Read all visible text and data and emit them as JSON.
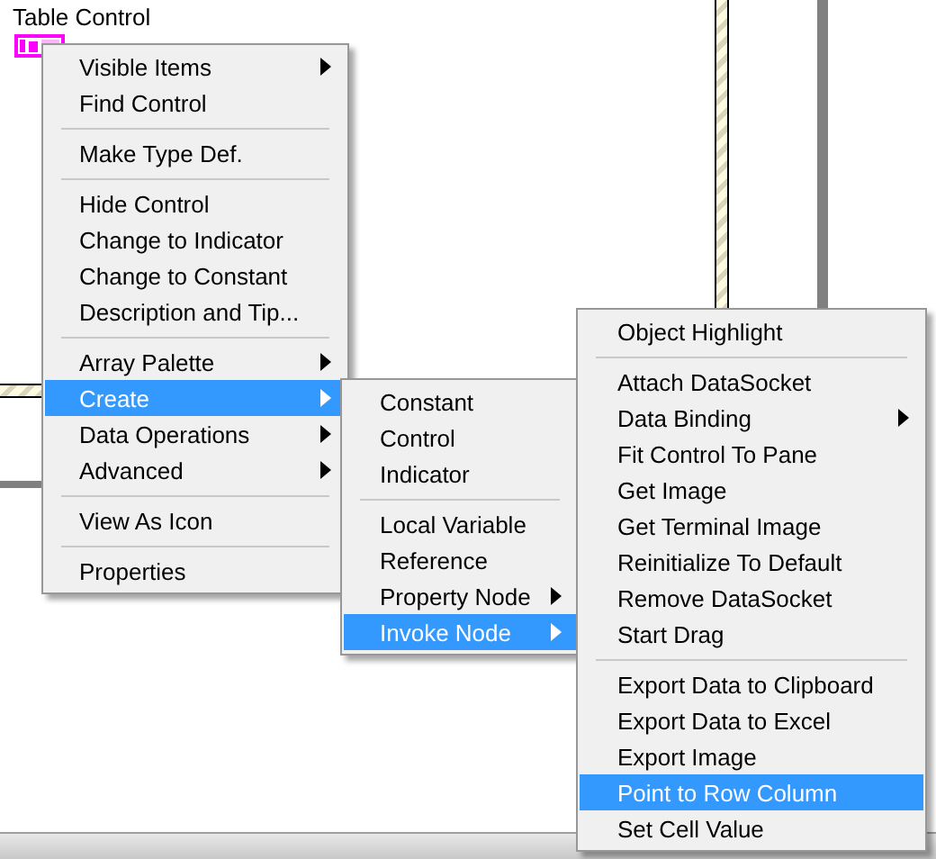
{
  "canvas": {
    "label": "Table Control"
  },
  "menus": [
    {
      "items": [
        {
          "kind": "item",
          "label": "Visible Items",
          "submenu": true,
          "selected": false
        },
        {
          "kind": "item",
          "label": "Find Control",
          "submenu": false,
          "selected": false
        },
        {
          "kind": "separator"
        },
        {
          "kind": "item",
          "label": "Make Type Def.",
          "submenu": false,
          "selected": false
        },
        {
          "kind": "separator"
        },
        {
          "kind": "item",
          "label": "Hide Control",
          "submenu": false,
          "selected": false
        },
        {
          "kind": "item",
          "label": "Change to Indicator",
          "submenu": false,
          "selected": false
        },
        {
          "kind": "item",
          "label": "Change to Constant",
          "submenu": false,
          "selected": false
        },
        {
          "kind": "item",
          "label": "Description and Tip...",
          "submenu": false,
          "selected": false
        },
        {
          "kind": "separator"
        },
        {
          "kind": "item",
          "label": "Array Palette",
          "submenu": true,
          "selected": false
        },
        {
          "kind": "item",
          "label": "Create",
          "submenu": true,
          "selected": true
        },
        {
          "kind": "item",
          "label": "Data Operations",
          "submenu": true,
          "selected": false
        },
        {
          "kind": "item",
          "label": "Advanced",
          "submenu": true,
          "selected": false
        },
        {
          "kind": "separator"
        },
        {
          "kind": "item",
          "label": "View As Icon",
          "submenu": false,
          "selected": false
        },
        {
          "kind": "separator"
        },
        {
          "kind": "item",
          "label": "Properties",
          "submenu": false,
          "selected": false
        }
      ]
    },
    {
      "items": [
        {
          "kind": "item",
          "label": "Constant",
          "submenu": false,
          "selected": false
        },
        {
          "kind": "item",
          "label": "Control",
          "submenu": false,
          "selected": false
        },
        {
          "kind": "item",
          "label": "Indicator",
          "submenu": false,
          "selected": false
        },
        {
          "kind": "separator"
        },
        {
          "kind": "item",
          "label": "Local Variable",
          "submenu": false,
          "selected": false
        },
        {
          "kind": "item",
          "label": "Reference",
          "submenu": false,
          "selected": false
        },
        {
          "kind": "item",
          "label": "Property Node",
          "submenu": true,
          "selected": false
        },
        {
          "kind": "item",
          "label": "Invoke Node",
          "submenu": true,
          "selected": true
        }
      ]
    },
    {
      "items": [
        {
          "kind": "item",
          "label": "Object Highlight",
          "submenu": false,
          "selected": false
        },
        {
          "kind": "separator"
        },
        {
          "kind": "item",
          "label": "Attach DataSocket",
          "submenu": false,
          "selected": false
        },
        {
          "kind": "item",
          "label": "Data Binding",
          "submenu": true,
          "selected": false
        },
        {
          "kind": "item",
          "label": "Fit Control To Pane",
          "submenu": false,
          "selected": false
        },
        {
          "kind": "item",
          "label": "Get Image",
          "submenu": false,
          "selected": false
        },
        {
          "kind": "item",
          "label": "Get Terminal Image",
          "submenu": false,
          "selected": false
        },
        {
          "kind": "item",
          "label": "Reinitialize To Default",
          "submenu": false,
          "selected": false
        },
        {
          "kind": "item",
          "label": "Remove DataSocket",
          "submenu": false,
          "selected": false
        },
        {
          "kind": "item",
          "label": "Start Drag",
          "submenu": false,
          "selected": false
        },
        {
          "kind": "separator"
        },
        {
          "kind": "item",
          "label": "Export Data to Clipboard",
          "submenu": false,
          "selected": false
        },
        {
          "kind": "item",
          "label": "Export Data to Excel",
          "submenu": false,
          "selected": false
        },
        {
          "kind": "item",
          "label": "Export Image",
          "submenu": false,
          "selected": false
        },
        {
          "kind": "item",
          "label": "Point to Row Column",
          "submenu": false,
          "selected": true
        },
        {
          "kind": "item",
          "label": "Set Cell Value",
          "submenu": false,
          "selected": false
        }
      ]
    }
  ]
}
